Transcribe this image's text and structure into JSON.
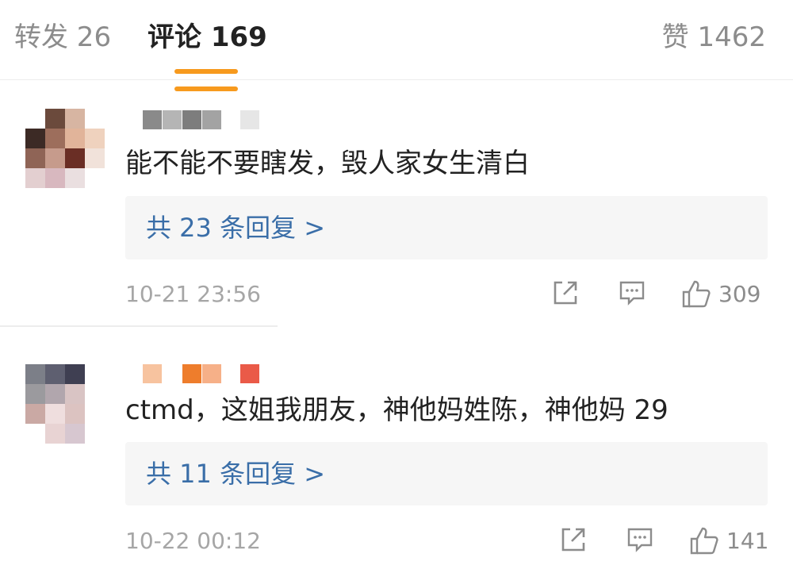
{
  "tabs": {
    "repost": "转发 26",
    "comments": "评论 169",
    "likes": "赞 1462"
  },
  "colors": {
    "accent": "#f79a1e",
    "link": "#3a6ea8",
    "muted": "#a6a6a6"
  },
  "comments": [
    {
      "text": "能不能不要瞎发，毁人家女生清白",
      "replies": "共 23 条回复 >",
      "time": "10-21 23:56",
      "likes": "309",
      "icons": [
        "share-icon",
        "comment-icon",
        "thumbs-up-icon"
      ]
    },
    {
      "text": "ctmd，这姐我朋友，神他妈姓陈，神他妈 29",
      "replies": "共 11 条回复 >",
      "time": "10-22 00:12",
      "likes": "141",
      "icons": [
        "share-icon",
        "comment-icon",
        "thumbs-up-icon"
      ]
    }
  ]
}
